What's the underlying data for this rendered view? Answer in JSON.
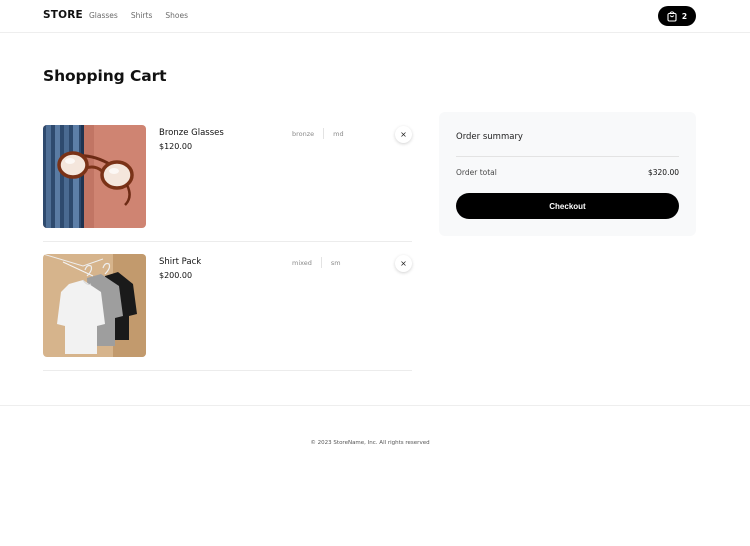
{
  "header": {
    "logo": "STORE",
    "nav": [
      "Glasses",
      "Shirts",
      "Shoes"
    ],
    "cart_count": "2"
  },
  "page": {
    "title": "Shopping Cart"
  },
  "cart": {
    "items": [
      {
        "name": "Bronze Glasses",
        "price": "$120.00",
        "color": "bronze",
        "size": "md",
        "remove_label": "×"
      },
      {
        "name": "Shirt Pack",
        "price": "$200.00",
        "color": "mixed",
        "size": "sm",
        "remove_label": "×"
      }
    ]
  },
  "summary": {
    "title": "Order summary",
    "total_label": "Order total",
    "total_value": "$320.00",
    "checkout_label": "Checkout"
  },
  "footer": {
    "copyright": "© 2023 StoreName, Inc. All rights reserved"
  },
  "colors": {
    "accent": "#000000",
    "summary_bg": "#f8f9fa",
    "muted_text": "#8a8a8a"
  }
}
